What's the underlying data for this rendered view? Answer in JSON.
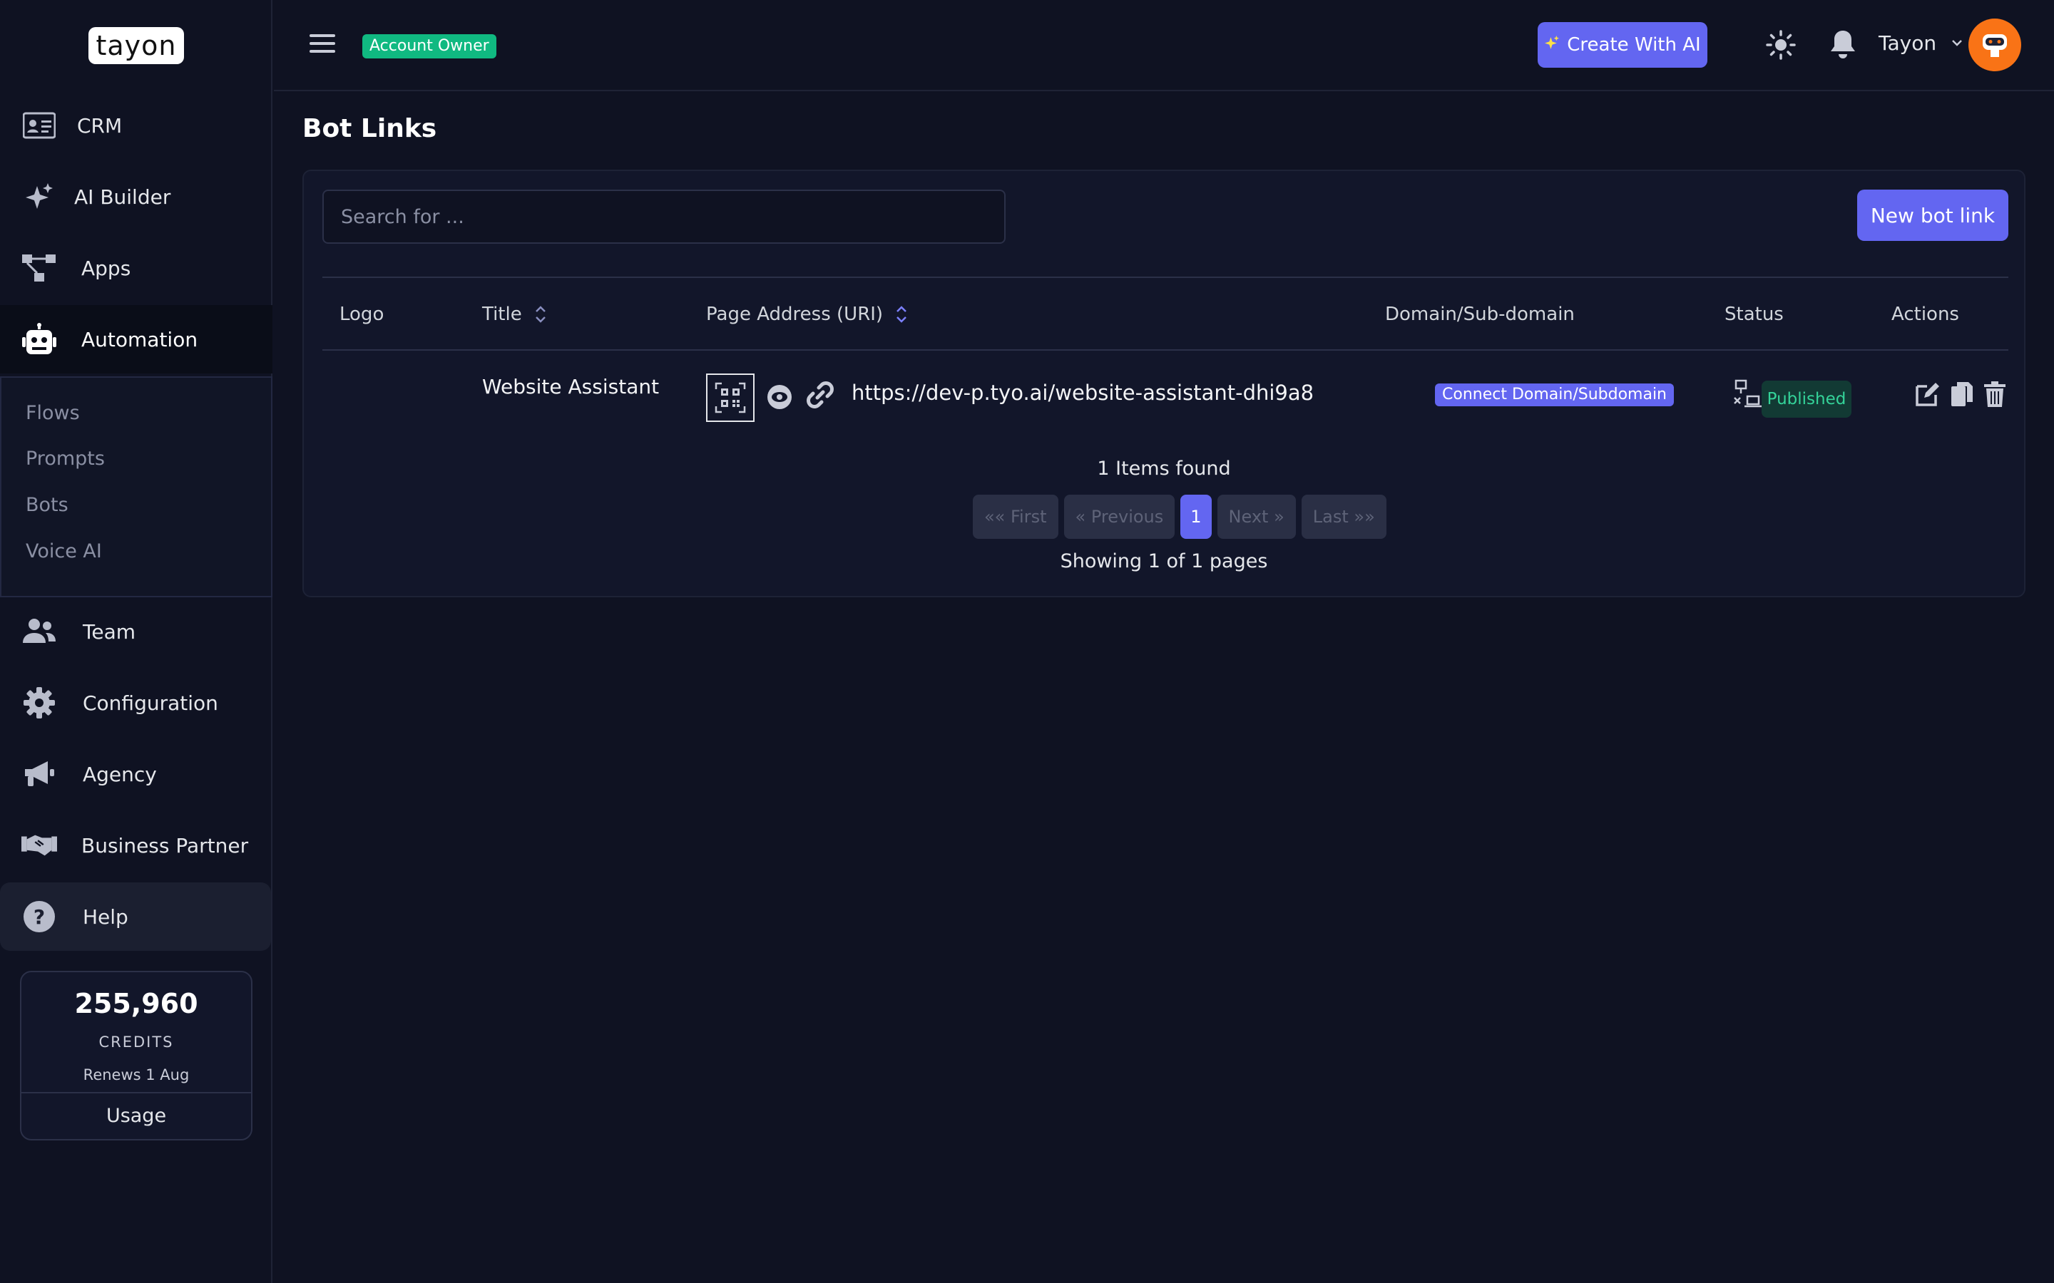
{
  "brand": {
    "logo_text": "tayon"
  },
  "sidebar": {
    "items": [
      {
        "label": "CRM",
        "icon": "id-card-icon"
      },
      {
        "label": "AI Builder",
        "icon": "sparkles-icon"
      },
      {
        "label": "Apps",
        "icon": "apps-flow-icon"
      },
      {
        "label": "Automation",
        "icon": "robot-icon",
        "active": true
      },
      {
        "label": "Team",
        "icon": "users-icon"
      },
      {
        "label": "Configuration",
        "icon": "gear-icon"
      },
      {
        "label": "Agency",
        "icon": "megaphone-icon"
      },
      {
        "label": "Business Partner",
        "icon": "handshake-icon"
      },
      {
        "label": "Help",
        "icon": "question-icon"
      }
    ],
    "submenu": [
      "Flows",
      "Prompts",
      "Bots",
      "Voice AI"
    ],
    "credits": {
      "amount": "255,960",
      "caption": "CREDITS",
      "renews": "Renews 1 Aug",
      "usage_label": "Usage"
    }
  },
  "header": {
    "role_badge": "Account Owner",
    "create_ai_label": "Create With AI",
    "username": "Tayon"
  },
  "page": {
    "title": "Bot Links",
    "search_placeholder": "Search for ...",
    "new_button": "New bot link",
    "columns": [
      "Logo",
      "Title",
      "Page Address (URI)",
      "Domain/Sub-domain",
      "Status",
      "Actions"
    ],
    "rows": [
      {
        "title": "Website Assistant",
        "url": "https://dev-p.tyo.ai/website-assistant-dhi9a8",
        "domain_action": "Connect Domain/Subdomain",
        "status": "Published"
      }
    ],
    "items_found": "1 Items found",
    "pagination": {
      "first": "«« First",
      "previous": "« Previous",
      "current": "1",
      "next": "Next »",
      "last": "Last »»"
    },
    "showing": "Showing 1 of 1 pages"
  },
  "colors": {
    "background": "#0f1222",
    "accent": "#6366f1",
    "success": "#10b981",
    "avatar": "#f97316"
  }
}
